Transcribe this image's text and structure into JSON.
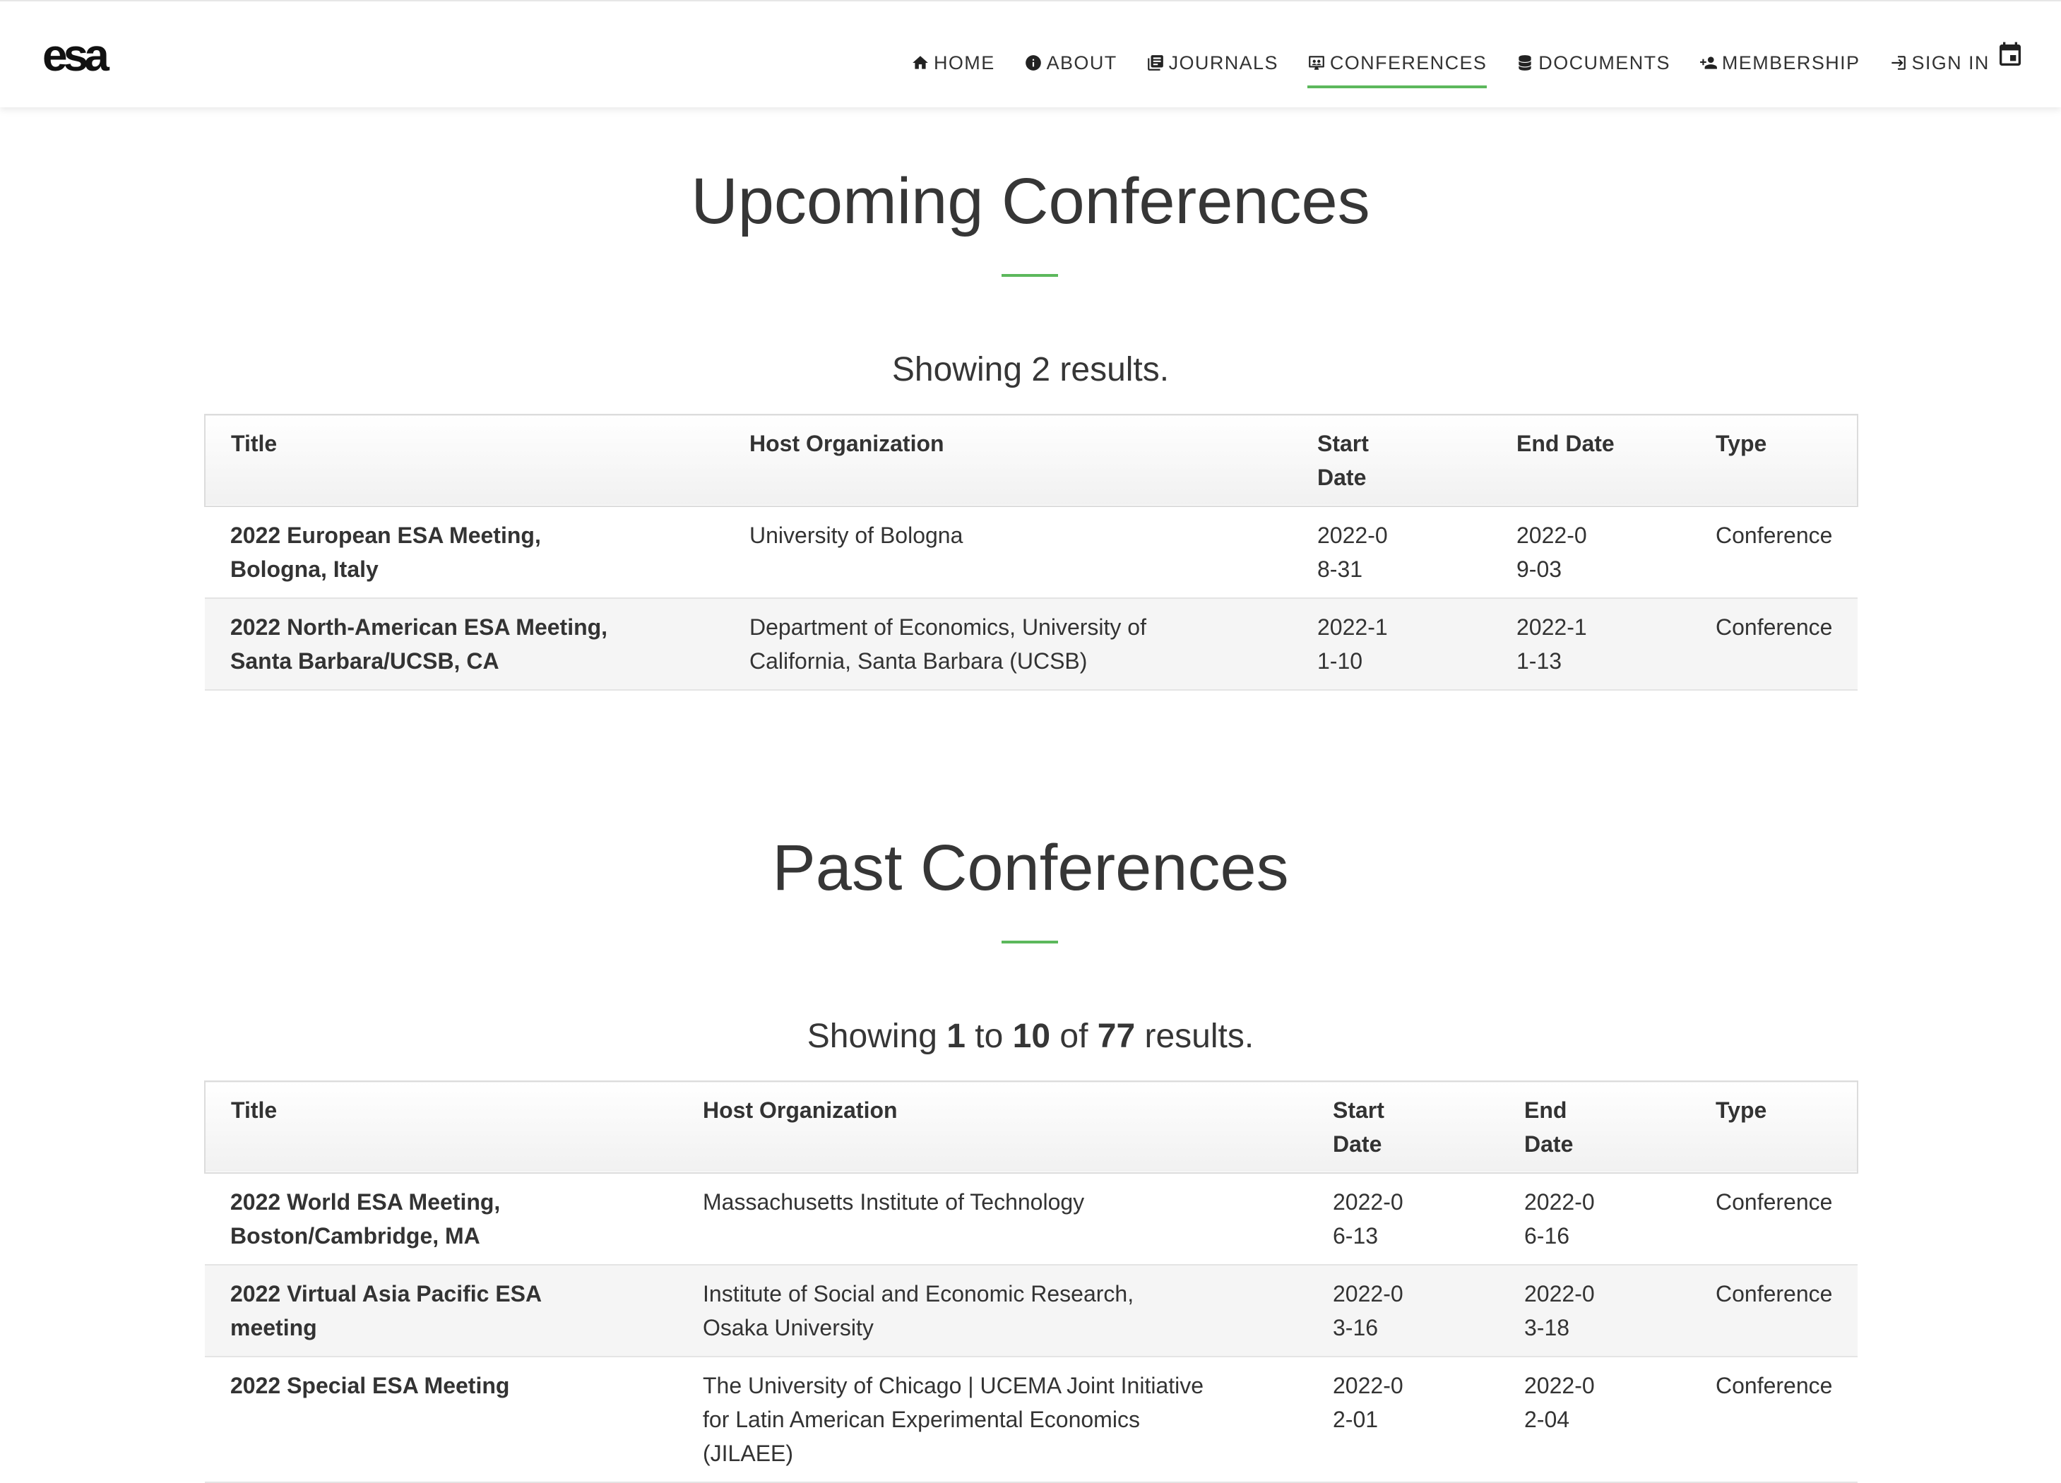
{
  "brand": {
    "logo_text": "esa"
  },
  "nav": [
    {
      "label": "HOME",
      "icon": "home-icon",
      "active": false
    },
    {
      "label": "ABOUT",
      "icon": "info-icon",
      "active": false
    },
    {
      "label": "JOURNALS",
      "icon": "book-icon",
      "active": false
    },
    {
      "label": "CONFERENCES",
      "icon": "presentation-icon",
      "active": true
    },
    {
      "label": "DOCUMENTS",
      "icon": "database-icon",
      "active": false
    },
    {
      "label": "MEMBERSHIP",
      "icon": "add-user-icon",
      "active": false
    },
    {
      "label": "SIGN IN",
      "icon": "sign-in-icon",
      "active": false
    }
  ],
  "calendar_icon": "calendar-icon",
  "accent_color": "#5cb85c",
  "upcoming": {
    "heading": "Upcoming Conferences",
    "results_text": "Showing 2 results.",
    "columns": [
      "Title",
      "Host Organization",
      "Start Date",
      "End Date",
      "Type"
    ],
    "rows": [
      {
        "title": "2022 European ESA Meeting, Bologna, Italy",
        "host": "University of Bologna",
        "start": "2022-08-31",
        "end": "2022-09-03",
        "type": "Conference"
      },
      {
        "title": "2022 North-American ESA Meeting, Santa Barbara/UCSB, CA",
        "host": "Department of Economics, University of California, Santa Barbara (UCSB)",
        "start": "2022-11-10",
        "end": "2022-11-13",
        "type": "Conference"
      }
    ]
  },
  "past": {
    "heading": "Past Conferences",
    "results_prefix": "Showing",
    "results_from": "1",
    "results_to_word": "to",
    "results_to": "10",
    "results_of_word": "of",
    "results_total": "77",
    "results_suffix": "results.",
    "columns": [
      "Title",
      "Host Organization",
      "Start Date",
      "End Date",
      "Type"
    ],
    "rows": [
      {
        "title": "2022 World ESA Meeting, Boston/Cambridge, MA",
        "host": "Massachusetts Institute of Technology",
        "start": "2022-06-13",
        "end": "2022-06-16",
        "type": "Conference"
      },
      {
        "title": "2022 Virtual Asia Pacific ESA meeting",
        "host": "Institute of Social and Economic Research, Osaka University",
        "start": "2022-03-16",
        "end": "2022-03-18",
        "type": "Conference"
      },
      {
        "title": "2022 Special ESA Meeting",
        "host": "The University of Chicago | UCEMA Joint Initiative for Latin American Experimental Economics (JILAEE)",
        "start": "2022-02-01",
        "end": "2022-02-04",
        "type": "Conference"
      }
    ]
  }
}
